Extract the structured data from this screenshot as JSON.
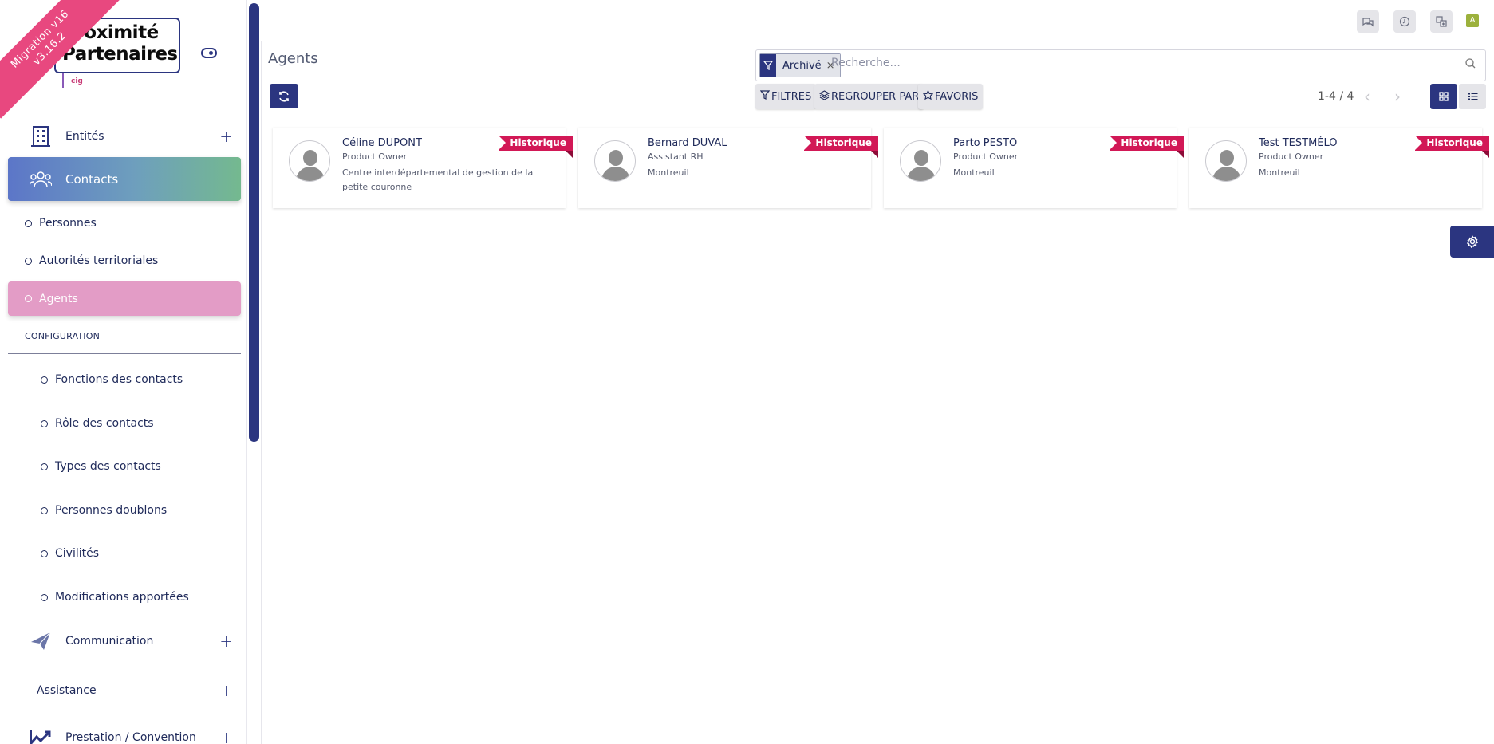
{
  "brand": {
    "ribbon_line1": "Migration v16",
    "ribbon_line2": "v3.16.2",
    "logo_line1": "Proximité",
    "logo_line2": "Partenaires",
    "logo_sub": "cig"
  },
  "sidebar": {
    "entites_label": "Entités",
    "contacts_label": "Contacts",
    "sub_items": [
      "Personnes",
      "Autorités territoriales",
      "Agents"
    ],
    "config_label": "CONFIGURATION",
    "config_items": [
      "Fonctions des contacts",
      "Rôle des contacts",
      "Types des contacts",
      "Personnes doublons",
      "Civilités",
      "Modifications apportées"
    ],
    "communication_label": "Communication",
    "assistance_label": "Assistance",
    "prestation_label": "Prestation / Convention"
  },
  "topbar": {
    "icons": [
      "chat-icon",
      "clock-icon",
      "translate-icon"
    ],
    "avatar_letter": "A"
  },
  "control": {
    "page_title": "Agents",
    "facet_value": "Archivé",
    "facet_close": "×",
    "search_placeholder": "Recherche...",
    "filters_label": "FILTRES",
    "groupby_label": "REGROUPER PAR",
    "favorites_label": "FAVORIS",
    "pager": "1-4 / 4"
  },
  "cards": [
    {
      "name": "Céline DUPONT",
      "role": "Product Owner",
      "location": "Centre interdépartemental de gestion de la petite couronne",
      "ribbon": "Historique"
    },
    {
      "name": "Bernard DUVAL",
      "role": "Assistant RH",
      "location": "Montreuil",
      "ribbon": "Historique"
    },
    {
      "name": "Parto PESTO",
      "role": "Product Owner",
      "location": "Montreuil",
      "ribbon": "Historique"
    },
    {
      "name": "Test TESTMÉLO",
      "role": "Product Owner",
      "location": "Montreuil",
      "ribbon": "Historique"
    }
  ],
  "colors": {
    "primary": "#2b3580",
    "ribbon": "#d21856",
    "agents_active": "#e39cc6",
    "brand_ribbon": "#e8487f"
  }
}
